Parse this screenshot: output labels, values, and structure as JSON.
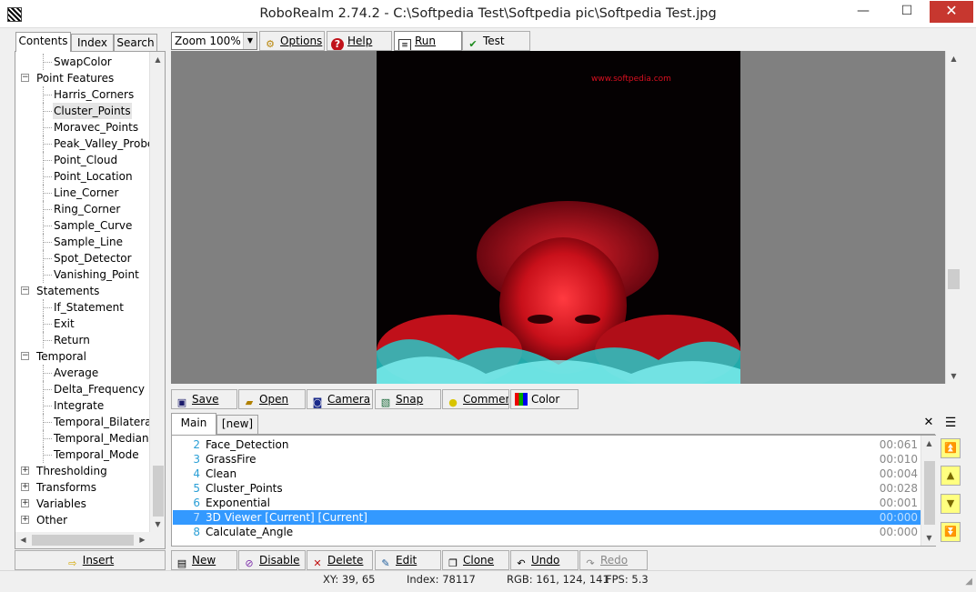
{
  "window": {
    "title": "RoboRealm 2.74.2 - C:\\Softpedia Test\\Softpedia pic\\Softpedia Test.jpg",
    "minimize": "—",
    "maximize": "☐",
    "close": "✕"
  },
  "nav_tabs": [
    "Contents",
    "Index",
    "Search"
  ],
  "tree": [
    {
      "label": "SwapColor",
      "level": 1
    },
    {
      "label": "Point Features",
      "level": 0,
      "expander": "−"
    },
    {
      "label": "Harris_Corners",
      "level": 1
    },
    {
      "label": "Cluster_Points",
      "level": 1,
      "selected": true
    },
    {
      "label": "Moravec_Points",
      "level": 1
    },
    {
      "label": "Peak_Valley_Probe",
      "level": 1
    },
    {
      "label": "Point_Cloud",
      "level": 1
    },
    {
      "label": "Point_Location",
      "level": 1
    },
    {
      "label": "Line_Corner",
      "level": 1
    },
    {
      "label": "Ring_Corner",
      "level": 1
    },
    {
      "label": "Sample_Curve",
      "level": 1
    },
    {
      "label": "Sample_Line",
      "level": 1
    },
    {
      "label": "Spot_Detector",
      "level": 1
    },
    {
      "label": "Vanishing_Point",
      "level": 1
    },
    {
      "label": "Statements",
      "level": 0,
      "expander": "−"
    },
    {
      "label": "If_Statement",
      "level": 1
    },
    {
      "label": "Exit",
      "level": 1
    },
    {
      "label": "Return",
      "level": 1
    },
    {
      "label": "Temporal",
      "level": 0,
      "expander": "−"
    },
    {
      "label": "Average",
      "level": 1
    },
    {
      "label": "Delta_Frequency",
      "level": 1
    },
    {
      "label": "Integrate",
      "level": 1
    },
    {
      "label": "Temporal_Bilateral",
      "level": 1
    },
    {
      "label": "Temporal_Median",
      "level": 1
    },
    {
      "label": "Temporal_Mode",
      "level": 1
    },
    {
      "label": "Thresholding",
      "level": 0,
      "expander": "+"
    },
    {
      "label": "Transforms",
      "level": 0,
      "expander": "+"
    },
    {
      "label": "Variables",
      "level": 0,
      "expander": "+"
    },
    {
      "label": "Other",
      "level": 0,
      "expander": "+"
    }
  ],
  "insert_button": "Insert",
  "toolbar": {
    "zoom": "Zoom 100%",
    "options": "Options",
    "help": "Help",
    "run": "Run",
    "test": "Test"
  },
  "image": {
    "watermark_text": "www.softpedia.com"
  },
  "image_toolbar": [
    "Save",
    "Open",
    "Camera",
    "Snap",
    "Commen",
    "Color"
  ],
  "pipeline_tabs": [
    "Main",
    "[new]"
  ],
  "pipeline": [
    {
      "num": "2",
      "name": "Face_Detection",
      "time": "00:061"
    },
    {
      "num": "3",
      "name": "GrassFire",
      "time": "00:010"
    },
    {
      "num": "4",
      "name": "Clean",
      "time": "00:004"
    },
    {
      "num": "5",
      "name": "Cluster_Points",
      "time": "00:028"
    },
    {
      "num": "6",
      "name": "Exponential",
      "time": "00:001"
    },
    {
      "num": "7",
      "name": "3D Viewer [Current] [Current]",
      "time": "00:000",
      "selected": true
    },
    {
      "num": "8",
      "name": "Calculate_Angle",
      "time": "00:000"
    }
  ],
  "bottom_toolbar": [
    "New",
    "Disable",
    "Delete",
    "Edit",
    "Clone",
    "Undo",
    "Redo"
  ],
  "status": {
    "xy": "XY: 39, 65",
    "index": "Index: 78117",
    "rgb": "RGB: 161, 124, 141",
    "fps": "FPS: 5.3"
  },
  "colors": {
    "selection": "#3399ff",
    "close_red": "#c7372f",
    "image_bg": "#808080",
    "photo_red": "#c8101a",
    "photo_cyan": "#30d8d8"
  }
}
